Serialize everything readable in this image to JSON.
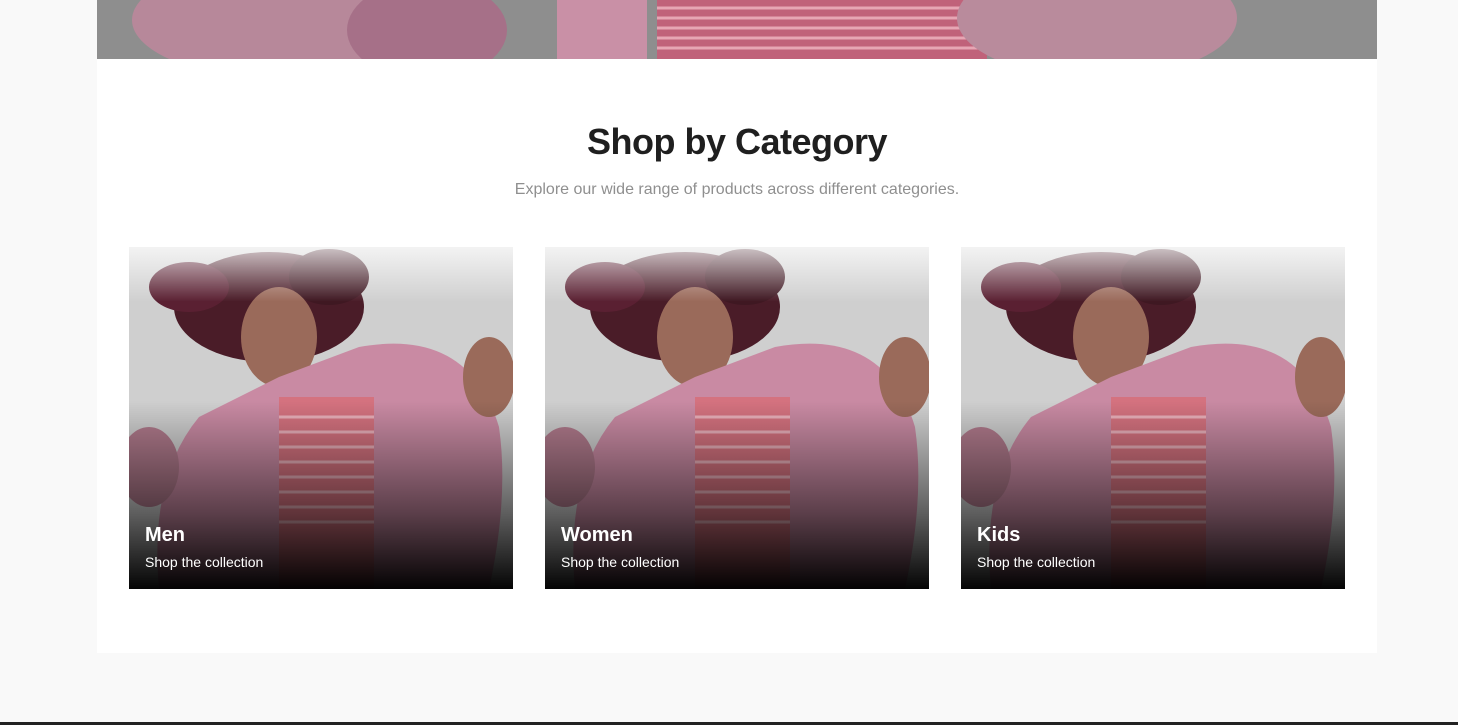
{
  "section": {
    "title": "Shop by Category",
    "subtitle": "Explore our wide range of products across different categories."
  },
  "categories": [
    {
      "name": "Men",
      "cta": "Shop the collection"
    },
    {
      "name": "Women",
      "cta": "Shop the collection"
    },
    {
      "name": "Kids",
      "cta": "Shop the collection"
    }
  ],
  "colors": {
    "page_background": "#f9f9f9",
    "panel_background": "#ffffff",
    "title": "#1f1f1f",
    "subtitle": "#8f8f8f",
    "card_text": "#ffffff",
    "jacket_pink": "#c98aa3",
    "top_stripes": "#d4727f"
  }
}
